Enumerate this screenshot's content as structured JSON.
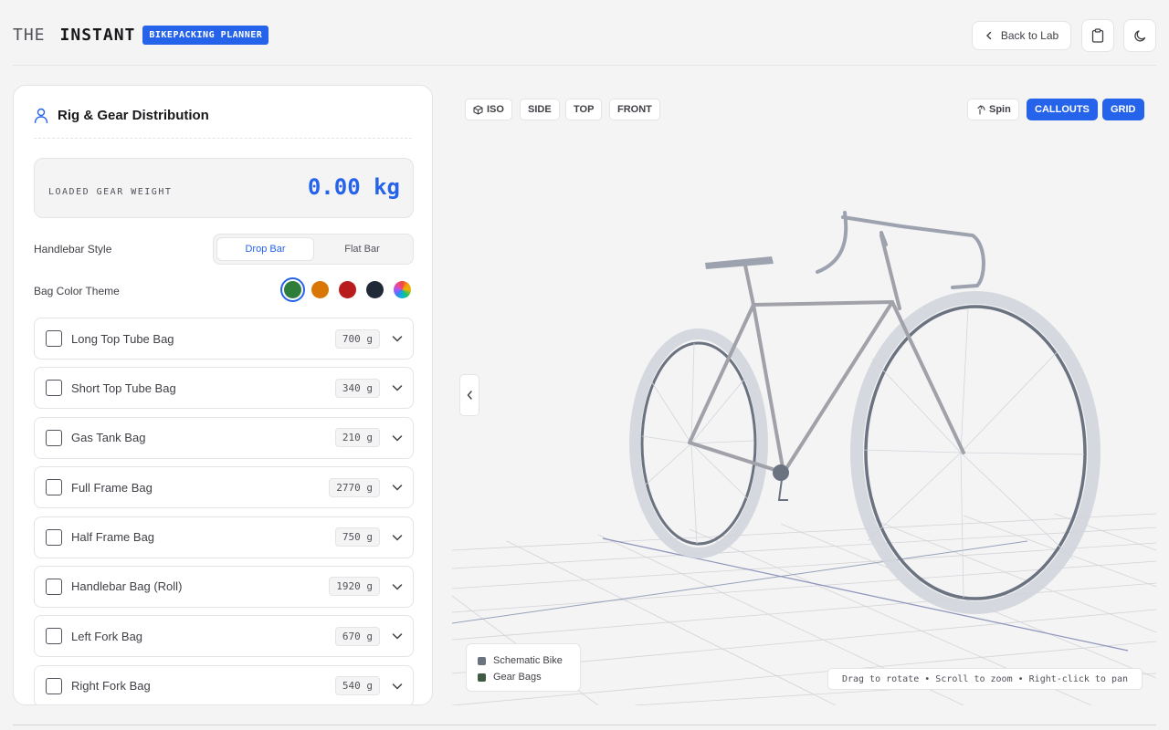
{
  "header": {
    "logo_the": "THE",
    "logo_instant": "INSTANT",
    "badge": "BIKEPACKING PLANNER",
    "back_label": "Back to Lab"
  },
  "panel": {
    "title": "Rig & Gear Distribution",
    "weight_label": "LOADED GEAR WEIGHT",
    "weight_value": "0.00 kg",
    "handlebar_label": "Handlebar Style",
    "handlebar_options": [
      "Drop Bar",
      "Flat Bar"
    ],
    "handlebar_selected": "Drop Bar",
    "color_label": "Bag Color Theme",
    "color_swatches": [
      "#2f7d3a",
      "#d97706",
      "#b91c1c",
      "#1f2937",
      "rainbow"
    ],
    "gear_items": [
      {
        "name": "Long Top Tube Bag",
        "weight": "700 g"
      },
      {
        "name": "Short Top Tube Bag",
        "weight": "340 g"
      },
      {
        "name": "Gas Tank Bag",
        "weight": "210 g"
      },
      {
        "name": "Full Frame Bag",
        "weight": "2770 g"
      },
      {
        "name": "Half Frame Bag",
        "weight": "750 g"
      },
      {
        "name": "Handlebar Bag (Roll)",
        "weight": "1920 g"
      },
      {
        "name": "Left Fork Bag",
        "weight": "670 g"
      },
      {
        "name": "Right Fork Bag",
        "weight": "540 g"
      }
    ]
  },
  "viewport": {
    "view_buttons": [
      "ISO",
      "SIDE",
      "TOP",
      "FRONT"
    ],
    "spin_label": "Spin",
    "callouts_label": "CALLOUTS",
    "grid_label": "GRID",
    "legend": [
      {
        "label": "Schematic Bike",
        "color": "#6b7280"
      },
      {
        "label": "Gear Bags",
        "color": "#3f5b45"
      }
    ],
    "hint": "Drag to rotate • Scroll to zoom • Right-click to pan"
  }
}
